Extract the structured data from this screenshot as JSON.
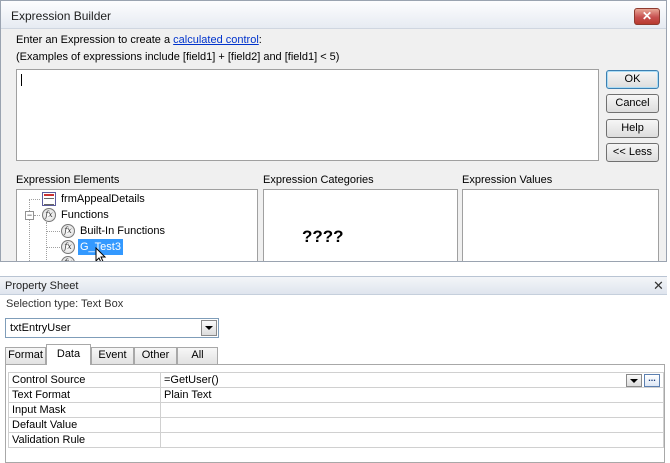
{
  "expression_builder": {
    "title": "Expression Builder",
    "close_glyph": "✕",
    "intro_prefix": "Enter an Expression to create a ",
    "intro_link": "calculated control",
    "intro_suffix": ":",
    "examples": "(Examples of expressions include [field1] + [field2] and [field1] < 5)",
    "expression_text": "",
    "buttons": {
      "ok": "OK",
      "cancel": "Cancel",
      "help": "Help",
      "less": "<< Less"
    },
    "panes": {
      "elements_label": "Expression Elements",
      "categories_label": "Expression Categories",
      "values_label": "Expression Values"
    },
    "elements_tree": [
      {
        "label": "frmAppealDetails",
        "icon": "form-icon"
      },
      {
        "label": "Functions",
        "icon": "function-icon",
        "expanded": true
      },
      {
        "label": "Built-In Functions",
        "icon": "function-icon"
      },
      {
        "label": "G_Test3",
        "icon": "function-icon",
        "selected": true
      }
    ],
    "categories_content": "????"
  },
  "property_sheet": {
    "title": "Property Sheet",
    "close_glyph": "✕",
    "selection_type": "Selection type:  Text Box",
    "object_combo_value": "txtEntryUser",
    "tabs": [
      "Format",
      "Data",
      "Event",
      "Other",
      "All"
    ],
    "active_tab": "Data",
    "rows": [
      {
        "name": "Control Source",
        "value": "=GetUser()"
      },
      {
        "name": "Text Format",
        "value": "Plain Text"
      },
      {
        "name": "Input Mask",
        "value": ""
      },
      {
        "name": "Default Value",
        "value": ""
      },
      {
        "name": "Validation Rule",
        "value": ""
      }
    ],
    "build_button_glyph": "..."
  }
}
